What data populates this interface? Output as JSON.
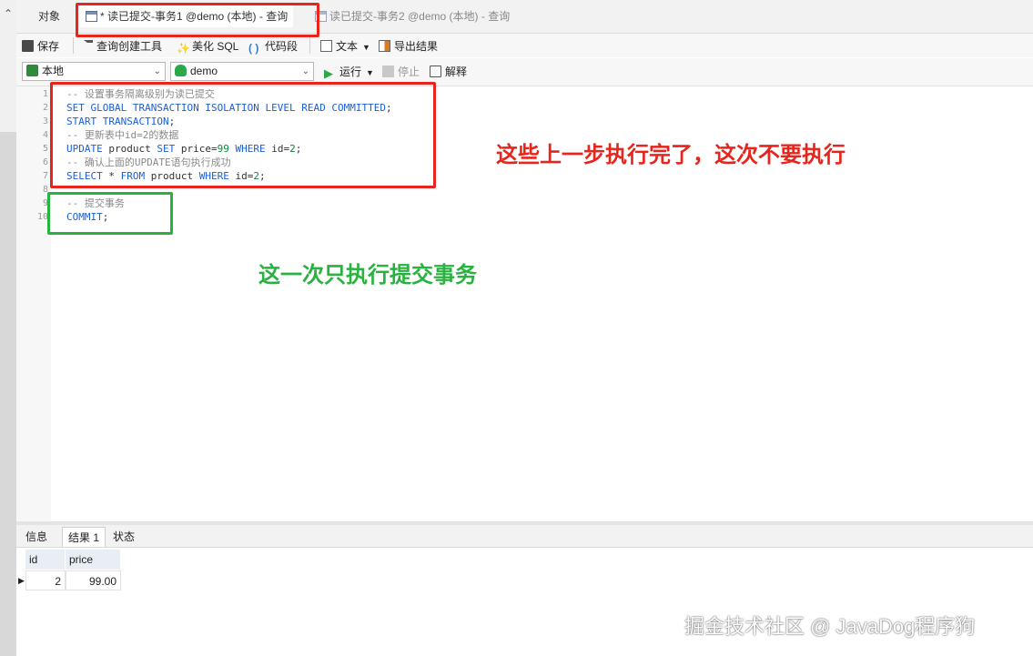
{
  "tabs": {
    "objects_label": "对象",
    "active_label": "* 读已提交-事务1 @demo (本地) - 查询",
    "second_label": "读已提交-事务2 @demo (本地) - 查询"
  },
  "toolbar": {
    "save": "保存",
    "query_builder": "查询创建工具",
    "beautify": "美化 SQL",
    "snippet": "代码段",
    "text": "文本",
    "export": "导出结果"
  },
  "toolbar2": {
    "connection": "本地",
    "database": "demo",
    "run": "运行",
    "stop": "停止",
    "explain": "解释"
  },
  "editor": {
    "line_numbers": [
      "1",
      "2",
      "3",
      "4",
      "5",
      "6",
      "7",
      "8",
      "9",
      "10"
    ],
    "lines": [
      [
        {
          "t": "-- 设置事务隔离级别为读已提交",
          "c": "cm"
        }
      ],
      [
        {
          "t": "SET GLOBAL TRANSACTION ISOLATION LEVEL READ COMMITTED",
          "c": "kw"
        },
        {
          "t": ";",
          "c": "plain"
        }
      ],
      [
        {
          "t": "START TRANSACTION",
          "c": "kw"
        },
        {
          "t": ";",
          "c": "plain"
        }
      ],
      [
        {
          "t": "-- 更新表中id=2的数据",
          "c": "cm"
        }
      ],
      [
        {
          "t": "UPDATE",
          "c": "kw"
        },
        {
          "t": " product ",
          "c": "plain"
        },
        {
          "t": "SET",
          "c": "kw"
        },
        {
          "t": " price=",
          "c": "plain"
        },
        {
          "t": "99",
          "c": "num"
        },
        {
          "t": " ",
          "c": "plain"
        },
        {
          "t": "WHERE",
          "c": "kw"
        },
        {
          "t": " id=",
          "c": "plain"
        },
        {
          "t": "2",
          "c": "num"
        },
        {
          "t": ";",
          "c": "plain"
        }
      ],
      [
        {
          "t": "-- 确认上面的UPDATE语句执行成功",
          "c": "cm"
        }
      ],
      [
        {
          "t": "SELECT",
          "c": "kw"
        },
        {
          "t": " * ",
          "c": "plain"
        },
        {
          "t": "FROM",
          "c": "kw"
        },
        {
          "t": " product ",
          "c": "plain"
        },
        {
          "t": "WHERE",
          "c": "kw"
        },
        {
          "t": " id=",
          "c": "plain"
        },
        {
          "t": "2",
          "c": "num"
        },
        {
          "t": ";",
          "c": "plain"
        }
      ],
      [],
      [
        {
          "t": "-- 提交事务",
          "c": "cm"
        }
      ],
      [
        {
          "t": "COMMIT",
          "c": "kw"
        },
        {
          "t": ";",
          "c": "plain"
        }
      ]
    ]
  },
  "annotations": {
    "red_note": "这些上一步执行完了，这次不要执行",
    "green_note": "这一次只执行提交事务",
    "red_color": "#e8251c",
    "green_color": "#2ab240"
  },
  "results": {
    "tabs": [
      "信息",
      "结果 1",
      "状态"
    ],
    "columns": [
      "id",
      "price"
    ],
    "rows": [
      [
        "2",
        "99.00"
      ]
    ]
  },
  "watermark": "掘金技术社区 @ JavaDog程序狗"
}
